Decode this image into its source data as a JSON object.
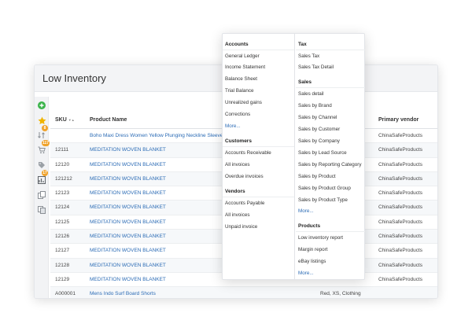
{
  "page": {
    "title": "Low Inventory"
  },
  "rail": {
    "icons": [
      {
        "name": "add-icon",
        "glyph": "+",
        "badge": ""
      },
      {
        "name": "star-icon",
        "glyph": "★",
        "badge": ""
      },
      {
        "name": "sort-icon",
        "glyph": "⇅",
        "badge": "8"
      },
      {
        "name": "cart-icon",
        "glyph": "🛒",
        "badge": "117"
      },
      {
        "name": "tag-icon",
        "glyph": "◆",
        "badge": ""
      },
      {
        "name": "chart-icon",
        "glyph": "▤",
        "badge": "17"
      },
      {
        "name": "copy-icon",
        "glyph": "❐",
        "badge": ""
      },
      {
        "name": "copy-alt-icon",
        "glyph": "❐",
        "badge": ""
      }
    ],
    "colors": {
      "add": "#3cb44b",
      "star": "#f0b400",
      "badge": "#f0a22a"
    }
  },
  "table": {
    "headers": {
      "sku": "SKU",
      "sort_indicator": "▼▲",
      "product_name": "Product Name",
      "vendor": "Primary vendor"
    },
    "rows": [
      {
        "sku": "",
        "name": "Boho Maxi Dress Women Yellow Plunging Neckline Sleeve",
        "vendor": "ChinaSafeProducts",
        "attrs": ""
      },
      {
        "sku": "12111",
        "name": "MEDITATION WOVEN BLANKET",
        "vendor": "ChinaSafeProducts",
        "attrs": ""
      },
      {
        "sku": "12120",
        "name": "MEDITATION WOVEN BLANKET",
        "vendor": "ChinaSafeProducts",
        "attrs": ""
      },
      {
        "sku": "121212",
        "name": "MEDITATION WOVEN BLANKET",
        "vendor": "ChinaSafeProducts",
        "attrs": ""
      },
      {
        "sku": "12123",
        "name": "MEDITATION WOVEN BLANKET",
        "vendor": "ChinaSafeProducts",
        "attrs": ""
      },
      {
        "sku": "12124",
        "name": "MEDITATION WOVEN BLANKET",
        "vendor": "ChinaSafeProducts",
        "attrs": ""
      },
      {
        "sku": "12125",
        "name": "MEDITATION WOVEN BLANKET",
        "vendor": "ChinaSafeProducts",
        "attrs": ""
      },
      {
        "sku": "12126",
        "name": "MEDITATION WOVEN BLANKET",
        "vendor": "ChinaSafeProducts",
        "attrs": ""
      },
      {
        "sku": "12127",
        "name": "MEDITATION WOVEN BLANKET",
        "vendor": "ChinaSafeProducts",
        "attrs": ""
      },
      {
        "sku": "12128",
        "name": "MEDITATION WOVEN BLANKET",
        "vendor": "ChinaSafeProducts",
        "attrs": ""
      },
      {
        "sku": "12129",
        "name": "MEDITATION WOVEN BLANKET",
        "vendor": "ChinaSafeProducts",
        "attrs": ""
      },
      {
        "sku": "A000001",
        "name": "Mens Indo Surf Board Shorts",
        "vendor": "",
        "attrs": "Red, XS, Clothing"
      }
    ]
  },
  "menu": {
    "accounts": {
      "title": "Accounts",
      "items": [
        "General Ledger",
        "Income Statement",
        "Balance Sheet",
        "Trial Balance",
        "Unrealized gains",
        "Corrections"
      ],
      "more": "More..."
    },
    "customers": {
      "title": "Customers",
      "items": [
        "Accounts Receivable",
        "All invoices",
        "Overdue invoices"
      ]
    },
    "vendors": {
      "title": "Vendors",
      "items": [
        "Accounts Payable",
        "All invoices",
        "Unpaid invoice"
      ]
    },
    "tax": {
      "title": "Tax",
      "items": [
        "Sales Tax",
        "Sales Tax Detail"
      ]
    },
    "sales": {
      "title": "Sales",
      "items": [
        "Sales detail",
        "Sales by Brand",
        "Sales by Channel",
        "Sales by Customer",
        "Sales by Company",
        "Sales by Lead Source",
        "Sales by Reporting Category",
        "Sales by Product",
        "Sales by Product Group",
        "Sales by Product Type"
      ],
      "more": "More..."
    },
    "products": {
      "title": "Products",
      "items": [
        "Low inventory report",
        "Margin report",
        "eBay listings"
      ],
      "more": "More..."
    },
    "colors": {
      "link": "#2b6bb5"
    }
  }
}
